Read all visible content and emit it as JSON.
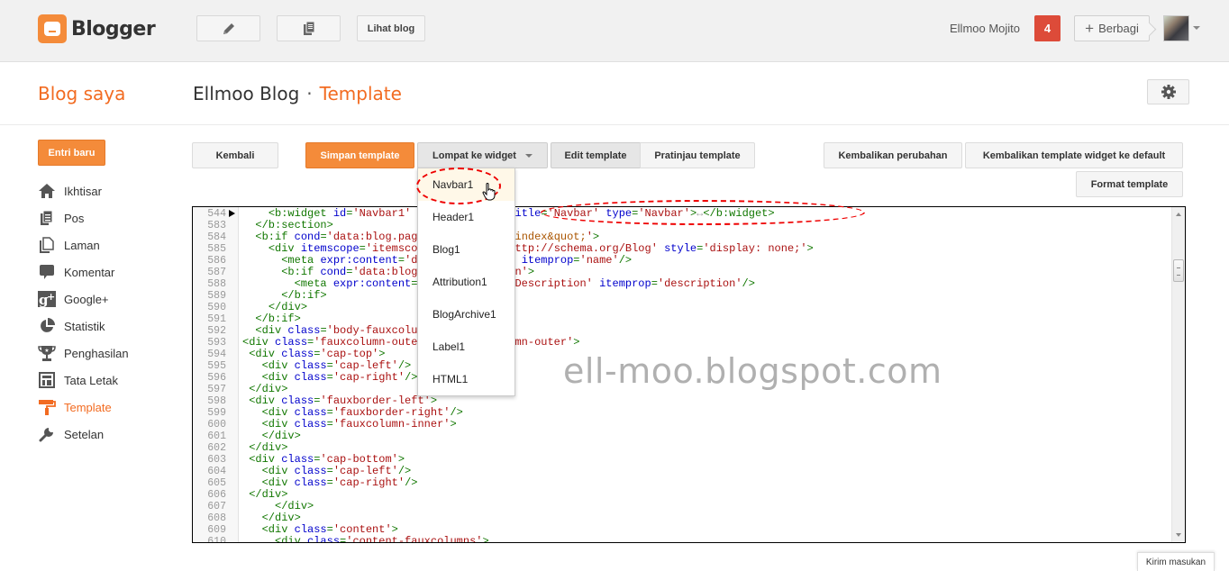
{
  "app": {
    "name": "Blogger"
  },
  "topbar": {
    "new_post_icon": "pencil-icon",
    "posts_icon": "pages-icon",
    "view_blog_label": "Lihat blog",
    "user_name": "Ellmoo Mojito",
    "notification_count": "4",
    "share_label": "Berbagi",
    "share_icon": "plus-icon"
  },
  "header": {
    "my_blogs": "Blog saya",
    "blog_name": "Ellmoo Blog",
    "separator": "·",
    "current_page": "Template",
    "settings_icon": "gear-icon"
  },
  "sidebar": {
    "new_post_label": "Entri baru",
    "items": [
      {
        "label": "Ikhtisar",
        "icon": "home-icon"
      },
      {
        "label": "Pos",
        "icon": "posts-icon"
      },
      {
        "label": "Laman",
        "icon": "page-icon"
      },
      {
        "label": "Komentar",
        "icon": "comment-icon"
      },
      {
        "label": "Google+",
        "icon": "google-plus-icon"
      },
      {
        "label": "Statistik",
        "icon": "pie-chart-icon"
      },
      {
        "label": "Penghasilan",
        "icon": "trophy-icon"
      },
      {
        "label": "Tata Letak",
        "icon": "layout-icon"
      },
      {
        "label": "Template",
        "icon": "paint-roller-icon",
        "active": true
      },
      {
        "label": "Setelan",
        "icon": "wrench-icon"
      }
    ]
  },
  "toolbar": {
    "back_label": "Kembali",
    "save_label": "Simpan template",
    "jump_label": "Lompat ke widget",
    "edit_label": "Edit template",
    "preview_label": "Pratinjau template",
    "revert_label": "Kembalikan perubahan",
    "reset_widgets_label": "Kembalikan template widget ke default",
    "format_label": "Format template"
  },
  "widget_menu": {
    "items": [
      "Navbar1",
      "Header1",
      "Blog1",
      "Attribution1",
      "BlogArchive1",
      "Label1",
      "HTML1"
    ],
    "hovered": "Navbar1"
  },
  "editor": {
    "lines": [
      {
        "n": "544",
        "folded": true,
        "html": "    <span class='t'>&lt;b:widget</span> <span class='k'>id</span><span class='t'>=</span><span class='s'>'Navbar1'</span> <span class='k'>locked</span><span class='t'>=</span><span class='s'>'true'</span> <span class='k'>title</span><span class='t'>=</span><span class='s'>'Navbar'</span> <span class='k'>type</span><span class='t'>=</span><span class='s'>'Navbar'</span><span class='t'>&gt;</span><span class='o'>↔</span><span class='t'>&lt;/b:widget&gt;</span>"
      },
      {
        "n": "583",
        "html": "  <span class='t'>&lt;/b:section&gt;</span>"
      },
      {
        "n": "584",
        "html": "  <span class='t'>&lt;b:if</span> <span class='k'>cond</span><span class='t'>=</span><span class='s'>'data:blog.pageType == <span class='q'>&amp;quot;index&amp;quot;</span>'</span><span class='t'>&gt;</span>"
      },
      {
        "n": "585",
        "html": "    <span class='t'>&lt;div</span> <span class='k'>itemscope</span><span class='t'>=</span><span class='s'>'itemscope'</span> <span class='k'>itemtype</span><span class='t'>=</span><span class='s'>'http://schema.org/Blog'</span> <span class='k'>style</span><span class='t'>=</span><span class='s'>'display: none;'</span><span class='t'>&gt;</span>"
      },
      {
        "n": "586",
        "html": "      <span class='t'>&lt;meta</span> <span class='k'>expr:content</span><span class='t'>=</span><span class='s'>'data:blog.title'</span> <span class='k'>itemprop</span><span class='t'>=</span><span class='s'>'name'</span><span class='t'>/&gt;</span>"
      },
      {
        "n": "587",
        "html": "      <span class='t'>&lt;b:if</span> <span class='k'>cond</span><span class='t'>=</span><span class='s'>'data:blog.metaDescription'</span><span class='t'>&gt;</span>"
      },
      {
        "n": "588",
        "html": "        <span class='t'>&lt;meta</span> <span class='k'>expr:content</span><span class='t'>=</span><span class='s'>'data:blog.metaDescription'</span> <span class='k'>itemprop</span><span class='t'>=</span><span class='s'>'description'</span><span class='t'>/&gt;</span>"
      },
      {
        "n": "589",
        "html": "      <span class='t'>&lt;/b:if&gt;</span>"
      },
      {
        "n": "590",
        "html": "    <span class='t'>&lt;/div&gt;</span>"
      },
      {
        "n": "591",
        "html": "  <span class='t'>&lt;/b:if&gt;</span>"
      },
      {
        "n": "592",
        "html": "  <span class='t'>&lt;div</span> <span class='k'>class</span><span class='t'>=</span><span class='s'>'body-fauxcolumns'</span><span class='t'>&gt;</span>"
      },
      {
        "n": "593",
        "html": "<span class='t'>&lt;div</span> <span class='k'>class</span><span class='t'>=</span><span class='s'>'fauxcolumn-outer body-fauxcolumn-outer'</span><span class='t'>&gt;</span>"
      },
      {
        "n": "594",
        "html": " <span class='t'>&lt;div</span> <span class='k'>class</span><span class='t'>=</span><span class='s'>'cap-top'</span><span class='t'>&gt;</span>"
      },
      {
        "n": "595",
        "html": "   <span class='t'>&lt;div</span> <span class='k'>class</span><span class='t'>=</span><span class='s'>'cap-left'</span><span class='t'>/&gt;</span>"
      },
      {
        "n": "596",
        "html": "   <span class='t'>&lt;div</span> <span class='k'>class</span><span class='t'>=</span><span class='s'>'cap-right'</span><span class='t'>/&gt;</span>"
      },
      {
        "n": "597",
        "html": " <span class='t'>&lt;/div&gt;</span>"
      },
      {
        "n": "598",
        "html": " <span class='t'>&lt;div</span> <span class='k'>class</span><span class='t'>=</span><span class='s'>'fauxborder-left'</span><span class='t'>&gt;</span>"
      },
      {
        "n": "599",
        "html": "   <span class='t'>&lt;div</span> <span class='k'>class</span><span class='t'>=</span><span class='s'>'fauxborder-right'</span><span class='t'>/&gt;</span>"
      },
      {
        "n": "600",
        "html": "   <span class='t'>&lt;div</span> <span class='k'>class</span><span class='t'>=</span><span class='s'>'fauxcolumn-inner'</span><span class='t'>&gt;</span>"
      },
      {
        "n": "601",
        "html": "   <span class='t'>&lt;/div&gt;</span>"
      },
      {
        "n": "602",
        "html": " <span class='t'>&lt;/div&gt;</span>"
      },
      {
        "n": "603",
        "html": " <span class='t'>&lt;div</span> <span class='k'>class</span><span class='t'>=</span><span class='s'>'cap-bottom'</span><span class='t'>&gt;</span>"
      },
      {
        "n": "604",
        "html": "   <span class='t'>&lt;div</span> <span class='k'>class</span><span class='t'>=</span><span class='s'>'cap-left'</span><span class='t'>/&gt;</span>"
      },
      {
        "n": "605",
        "html": "   <span class='t'>&lt;div</span> <span class='k'>class</span><span class='t'>=</span><span class='s'>'cap-right'</span><span class='t'>/&gt;</span>"
      },
      {
        "n": "606",
        "html": " <span class='t'>&lt;/div&gt;</span>"
      },
      {
        "n": "607",
        "html": "     <span class='t'>&lt;/div&gt;</span>"
      },
      {
        "n": "608",
        "html": "   <span class='t'>&lt;/div&gt;</span>"
      },
      {
        "n": "609",
        "html": "   <span class='t'>&lt;div</span> <span class='k'>class</span><span class='t'>=</span><span class='s'>'content'</span><span class='t'>&gt;</span>"
      },
      {
        "n": "610",
        "html": "     <span class='t'>&lt;div</span> <span class='k'>class</span><span class='t'>=</span><span class='s'>'content-fauxcolumns'</span><span class='t'>&gt;</span>"
      }
    ]
  },
  "watermark": "ell-moo.blogspot.com",
  "feedback_label": "Kirim masukan",
  "colors": {
    "brand_orange": "#f48b3a",
    "accent_orange_text": "#f26b21",
    "notification_red": "#dd4b39",
    "annotation_red": "#e00000"
  }
}
